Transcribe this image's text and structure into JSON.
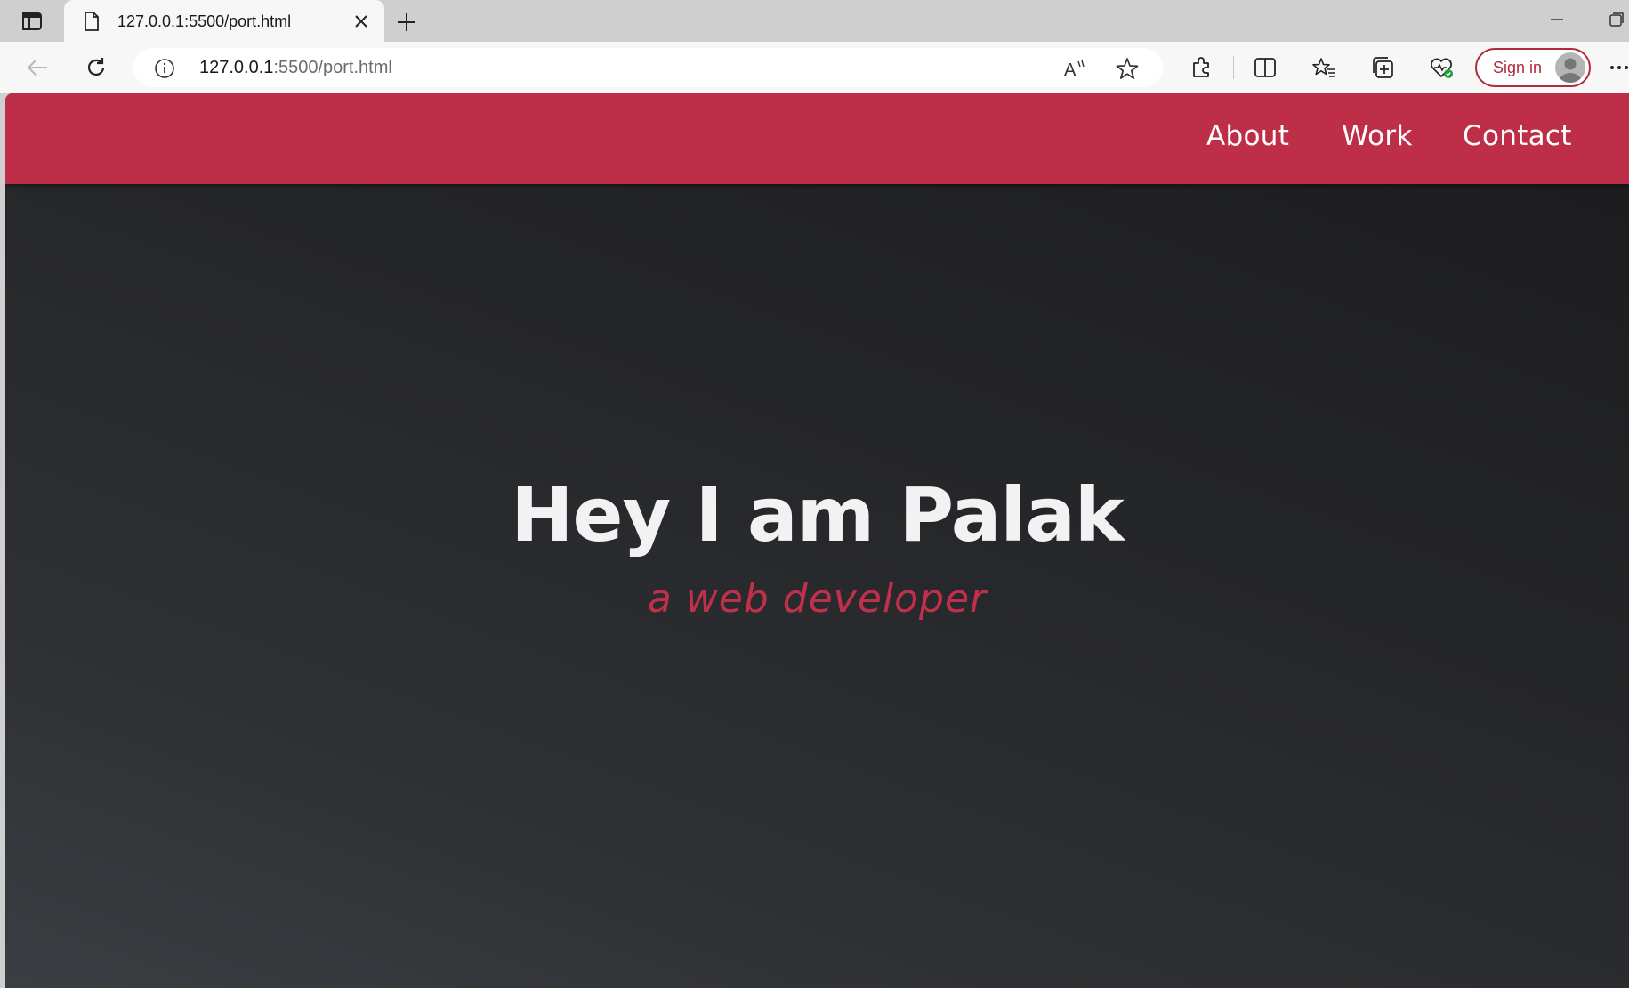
{
  "browser": {
    "tab": {
      "title": "127.0.0.1:5500/port.html"
    },
    "address": {
      "host": "127.0.0.1",
      "rest": ":5500/port.html"
    },
    "signin_label": "Sign in",
    "accent_color": "#b22a3a"
  },
  "site": {
    "nav": {
      "color": "#be2f47",
      "items": [
        {
          "label": "About"
        },
        {
          "label": "Work"
        },
        {
          "label": "Contact"
        }
      ]
    },
    "hero": {
      "title": "Hey I am Palak",
      "subtitle": "a web developer",
      "subtitle_color": "#c0304a"
    }
  }
}
